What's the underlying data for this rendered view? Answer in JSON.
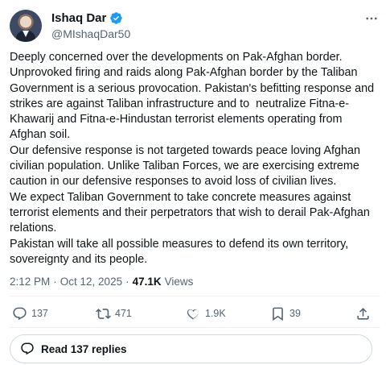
{
  "author": {
    "display_name": "Ishaq Dar",
    "handle": "@MIshaqDar50",
    "verified_color": "#1d9bf0"
  },
  "post": {
    "text": "Deeply concerned over the developments on Pak-Afghan border.\nUnprovoked firing and raids along Pak-Afghan border by the Taliban Government is a serious provocation. Pakistan's befitting response and strikes are against Taliban infrastructure and to  neutralize Fitna-e-Khawarij and Fitna-e-Hindustan terrorist elements operating from Afghan soil.\nOur defensive response is not targeted towards peace loving Afghan civilian population. Unlike Taliban Forces, we are exercising extreme caution in our defensive responses to avoid loss of civilian lives.\nWe expect Taliban Government to take concrete measures against terrorist elements and their perpetrators that wish to derail Pak-Afghan relations.\nPakistan will take all possible measures to defend its own territory, sovereignty and its people."
  },
  "meta": {
    "time": "2:12 PM",
    "separator": "·",
    "date": "Oct 12, 2025",
    "views_count": "47.1K",
    "views_label": "Views"
  },
  "actions": {
    "replies": "137",
    "reposts": "471",
    "likes": "1.9K",
    "bookmarks": "39"
  },
  "icons": {
    "more": "more-horizontal-icon",
    "reply": "reply-icon",
    "repost": "repost-icon",
    "like": "heart-icon",
    "bookmark": "bookmark-icon",
    "share": "share-icon",
    "replies_bubble": "speech-bubble-icon"
  },
  "read_replies": {
    "label": "Read 137 replies"
  }
}
